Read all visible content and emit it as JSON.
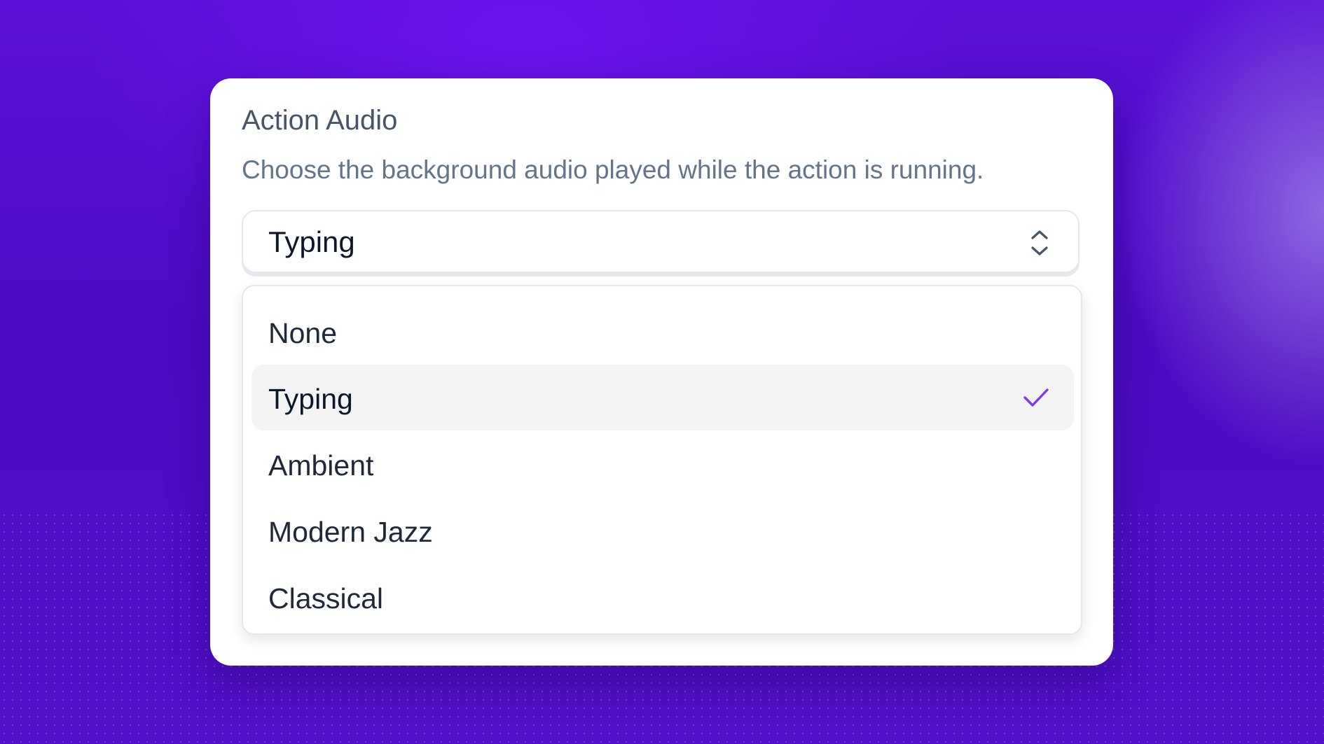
{
  "panel": {
    "title": "Action Audio",
    "description": "Choose the background audio played while the action is running."
  },
  "select": {
    "value": "Typing",
    "icon": "chevron-up-down-icon"
  },
  "options": [
    {
      "label": "None",
      "selected": false
    },
    {
      "label": "Typing",
      "selected": true
    },
    {
      "label": "Ambient",
      "selected": false
    },
    {
      "label": "Modern Jazz",
      "selected": false
    },
    {
      "label": "Classical",
      "selected": false
    }
  ],
  "colors": {
    "accent": "#7c3aed",
    "background": "#5010d0",
    "selected_row": "#f4f4f5"
  }
}
